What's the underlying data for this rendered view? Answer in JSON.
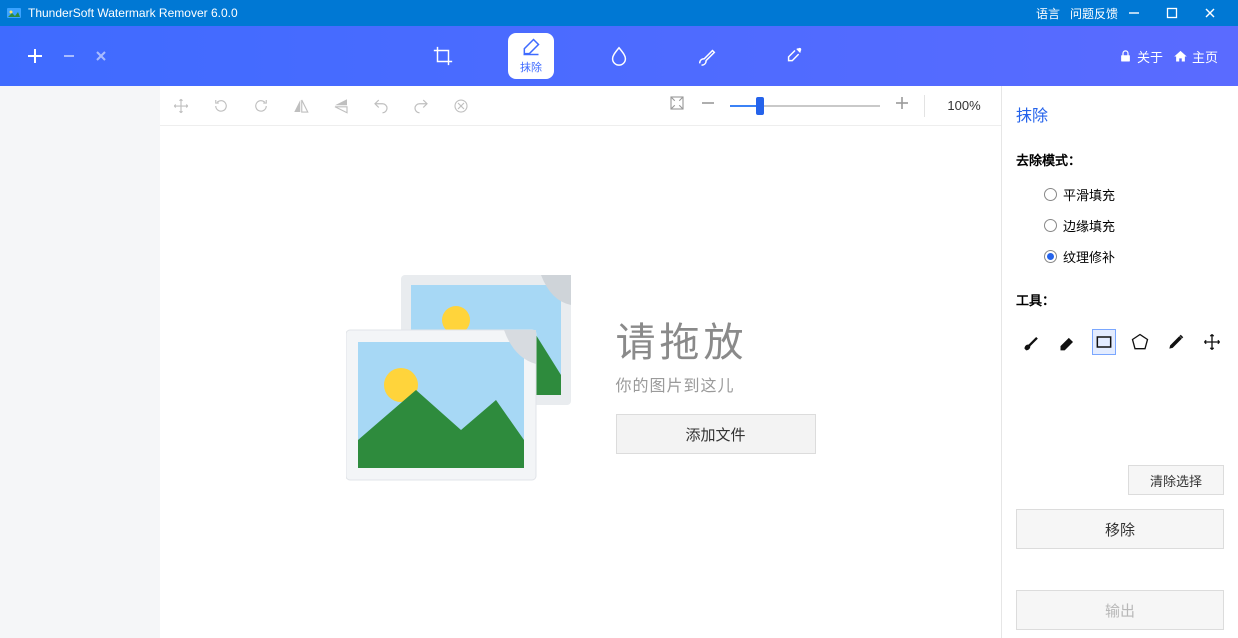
{
  "titlebar": {
    "app_title": "ThunderSoft Watermark Remover 6.0.0",
    "language": "语言",
    "feedback": "问题反馈"
  },
  "header": {
    "erase_label": "抹除",
    "about": "关于",
    "home": "主页"
  },
  "toolbar": {
    "zoom_label": "100%"
  },
  "dropzone": {
    "big": "请拖放",
    "small": "你的图片到这儿",
    "add_file": "添加文件"
  },
  "side": {
    "title": "抹除",
    "mode_label": "去除模式：",
    "mode_smooth": "平滑填充",
    "mode_edge": "边缘填充",
    "mode_texture": "纹理修补",
    "tools_label": "工具：",
    "clear_selection": "清除选择",
    "remove": "移除",
    "output": "输出"
  }
}
